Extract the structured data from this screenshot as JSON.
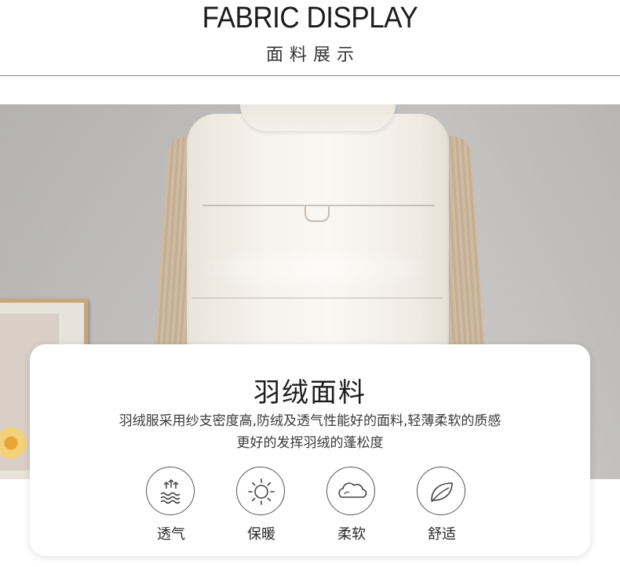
{
  "header": {
    "title": "FABRIC DISPLAY",
    "subtitle": "面料展示"
  },
  "card": {
    "title": "羽绒面料",
    "description_line1": "羽绒服采用纱支密度高,防绒及透气性能好的面料,轻薄柔软的质感",
    "description_line2": "更好的发挥羽绒的蓬松度"
  },
  "features": [
    {
      "label": "透气",
      "icon": "breathable-icon"
    },
    {
      "label": "保暖",
      "icon": "sun-warmth-icon"
    },
    {
      "label": "柔软",
      "icon": "cloud-soft-icon"
    },
    {
      "label": "舒适",
      "icon": "leaf-comfort-icon"
    }
  ],
  "colors": {
    "background": "#ffffff",
    "divider": "#8a8a8a",
    "text_dark": "#1d1d1d",
    "vest": "#f6f3ec",
    "knit_sleeve": "#cfbaa2",
    "wall": "#c2c1bf"
  }
}
